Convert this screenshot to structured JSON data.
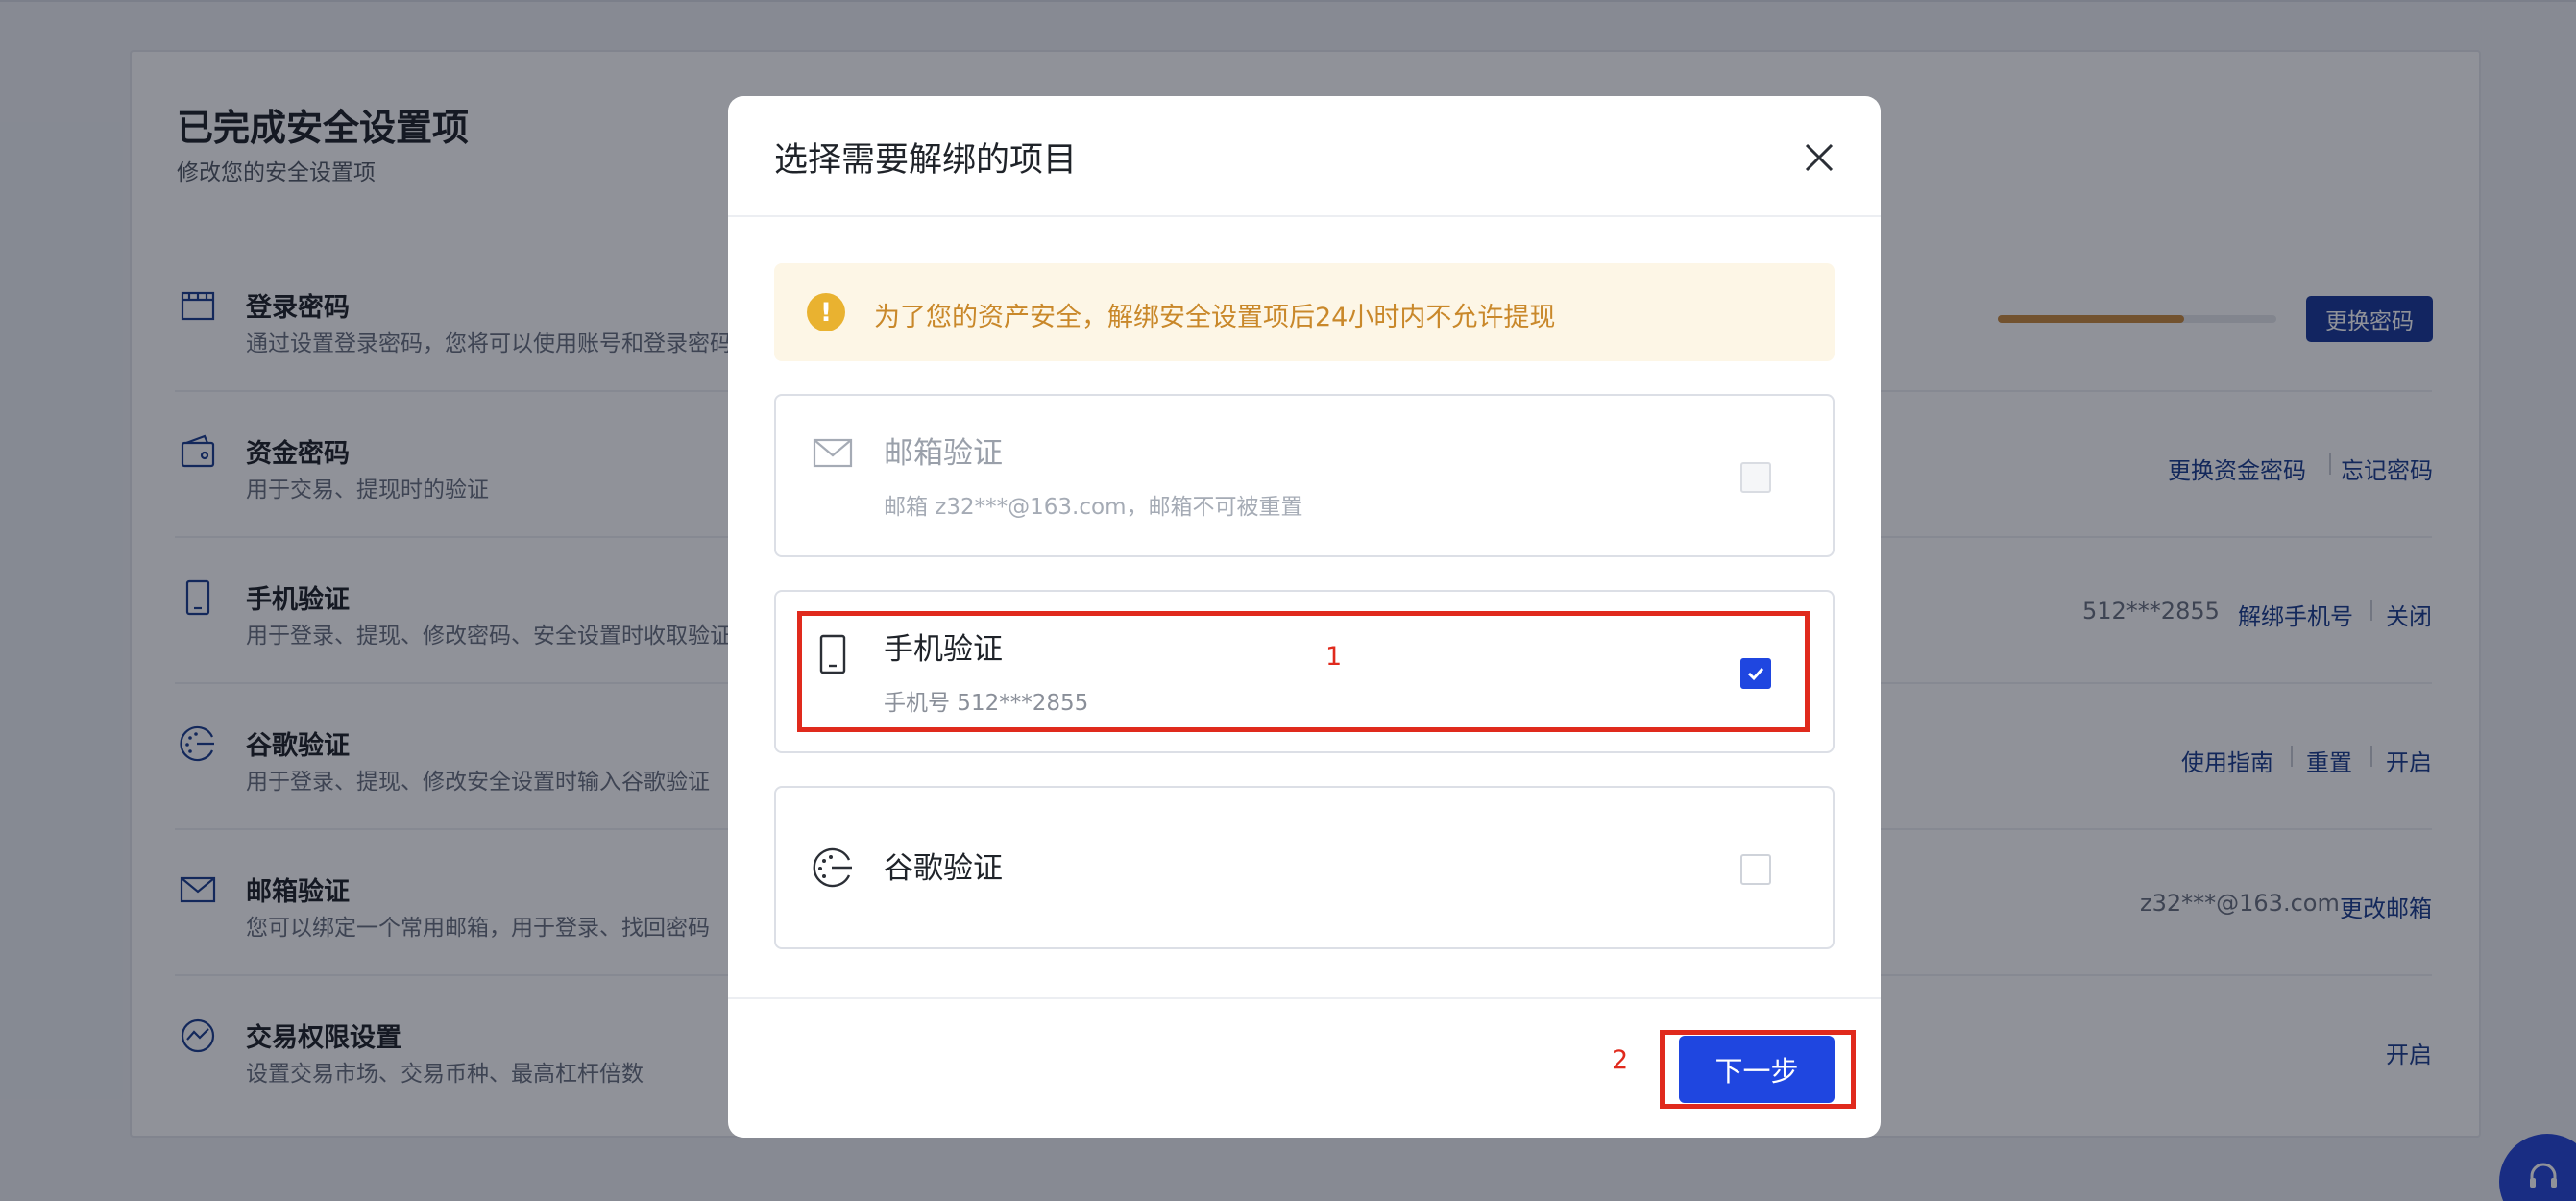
{
  "background": {
    "title": "已完成安全设置项",
    "subtitle": "修改您的安全设置项",
    "rows": [
      {
        "name": "登录密码",
        "desc": "通过设置登录密码，您将可以使用账号和登录密码"
      },
      {
        "name": "资金密码",
        "desc": "用于交易、提现时的验证"
      },
      {
        "name": "手机验证",
        "desc": "用于登录、提现、修改密码、安全设置时收取验证"
      },
      {
        "name": "谷歌验证",
        "desc": "用于登录、提现、修改安全设置时输入谷歌验证"
      },
      {
        "name": "邮箱验证",
        "desc": "您可以绑定一个常用邮箱，用于登录、找回密码"
      },
      {
        "name": "交易权限设置",
        "desc": "设置交易市场、交易币种、最高杠杆倍数"
      }
    ],
    "password_strength": 0.67,
    "actions": {
      "change_password": "更换密码",
      "change_fund_password": "更换资金密码",
      "forgot_password": "忘记密码",
      "phone_masked": "512***2855",
      "unbind_phone": "解绑手机号",
      "close": "关闭",
      "usage_guide": "使用指南",
      "reset": "重置",
      "enable": "开启",
      "email_masked": "z32***@163.com",
      "change_email": "更改邮箱",
      "trade_enable": "开启"
    }
  },
  "modal": {
    "title": "选择需要解绑的项目",
    "notice": "为了您的资产安全，解绑安全设置项后24小时内不允许提现",
    "options": [
      {
        "icon": "mail-icon",
        "title": "邮箱验证",
        "subtitle": "邮箱 z32***@163.com，邮箱不可被重置",
        "checked": false,
        "disabled": true
      },
      {
        "icon": "phone-icon",
        "title": "手机验证",
        "subtitle": "手机号 512***2855",
        "checked": true,
        "disabled": false
      },
      {
        "icon": "google-auth-icon",
        "title": "谷歌验证",
        "subtitle": "",
        "checked": false,
        "disabled": false
      }
    ],
    "next_label": "下一步"
  },
  "annotations": {
    "first": "1",
    "second": "2"
  },
  "colors": {
    "primary": "#1f46e0",
    "annotation": "#e02a1d",
    "notice_text": "#c9882a",
    "notice_bg": "#fdf6e6"
  }
}
